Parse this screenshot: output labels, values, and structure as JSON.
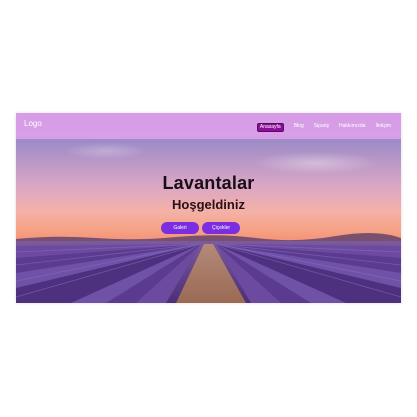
{
  "header": {
    "logo": "Logo",
    "nav": [
      "Anasayfa",
      "Blog",
      "Sipariş",
      "Hakkımızda",
      "İletişim"
    ],
    "active_index": 0
  },
  "hero": {
    "title": "Lavantalar",
    "subtitle": "Hoşgeldiniz",
    "buttons": [
      "Galeri",
      "Çiçekler"
    ]
  },
  "colors": {
    "nav_bg": "#dda0e9",
    "active_bg": "#8a0f96",
    "button_bg": "#7b2ee0",
    "lavender": "#6a4c9c"
  }
}
